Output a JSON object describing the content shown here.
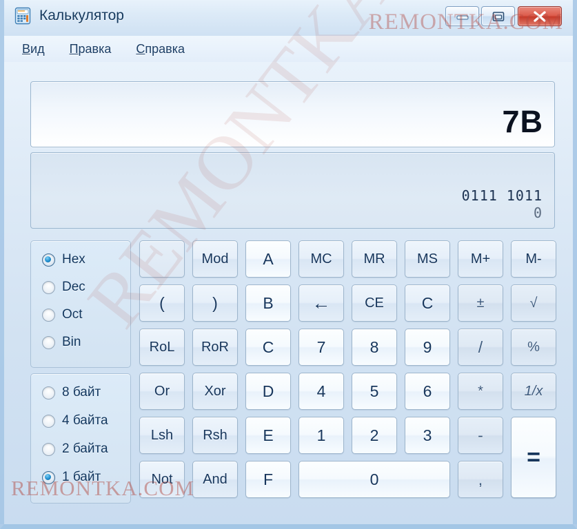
{
  "window": {
    "title": "Калькулятор",
    "icon": "calculator-icon",
    "controls": {
      "minimize": "minimize-icon",
      "maximize": "restore-icon",
      "close": "close-icon"
    }
  },
  "menu": {
    "items": [
      {
        "accel": "В",
        "rest": "ид"
      },
      {
        "accel": "П",
        "rest": "равка"
      },
      {
        "accel": "С",
        "rest": "правка"
      }
    ]
  },
  "display": {
    "value": "7B",
    "binary_line_1": "0111  1011",
    "binary_line_2": "0"
  },
  "base_group": {
    "options": [
      {
        "label": "Hex",
        "selected": true
      },
      {
        "label": "Dec",
        "selected": false
      },
      {
        "label": "Oct",
        "selected": false
      },
      {
        "label": "Bin",
        "selected": false
      }
    ]
  },
  "size_group": {
    "options": [
      {
        "label": "8 байт",
        "selected": false
      },
      {
        "label": "4 байта",
        "selected": false
      },
      {
        "label": "2 байта",
        "selected": false
      },
      {
        "label": "1 байт",
        "selected": true
      }
    ]
  },
  "keys": [
    {
      "name": "key-blank",
      "label": "",
      "style": "blank",
      "col": 0,
      "row": 0
    },
    {
      "name": "key-mod",
      "label": "Mod",
      "style": "op small",
      "col": 1,
      "row": 0
    },
    {
      "name": "key-hex-a",
      "label": "A",
      "style": "num",
      "col": 2,
      "row": 0
    },
    {
      "name": "key-mc",
      "label": "MC",
      "style": "op small",
      "col": 3,
      "row": 0
    },
    {
      "name": "key-mr",
      "label": "MR",
      "style": "op small",
      "col": 4,
      "row": 0
    },
    {
      "name": "key-ms",
      "label": "MS",
      "style": "op small",
      "col": 5,
      "row": 0
    },
    {
      "name": "key-m-plus",
      "label": "M+",
      "style": "op small",
      "col": 6,
      "row": 0
    },
    {
      "name": "key-m-minus",
      "label": "M-",
      "style": "op small",
      "col": 7,
      "row": 0
    },
    {
      "name": "key-paren-open",
      "label": "(",
      "style": "op",
      "col": 0,
      "row": 1
    },
    {
      "name": "key-paren-close",
      "label": ")",
      "style": "op",
      "col": 1,
      "row": 1
    },
    {
      "name": "key-hex-b",
      "label": "B",
      "style": "num",
      "col": 2,
      "row": 1
    },
    {
      "name": "key-backspace",
      "label": "←",
      "style": "op arrow",
      "col": 3,
      "row": 1
    },
    {
      "name": "key-ce",
      "label": "CE",
      "style": "op small",
      "col": 4,
      "row": 1
    },
    {
      "name": "key-c",
      "label": "C",
      "style": "op",
      "col": 5,
      "row": 1
    },
    {
      "name": "key-sign",
      "label": "±",
      "style": "dim small",
      "col": 6,
      "row": 1
    },
    {
      "name": "key-sqrt",
      "label": "√",
      "style": "dim small",
      "col": 7,
      "row": 1
    },
    {
      "name": "key-rol",
      "label": "RoL",
      "style": "op small",
      "col": 0,
      "row": 2
    },
    {
      "name": "key-ror",
      "label": "RoR",
      "style": "op small",
      "col": 1,
      "row": 2
    },
    {
      "name": "key-hex-c",
      "label": "C",
      "style": "num",
      "col": 2,
      "row": 2
    },
    {
      "name": "key-7",
      "label": "7",
      "style": "num",
      "col": 3,
      "row": 2
    },
    {
      "name": "key-8",
      "label": "8",
      "style": "num",
      "col": 4,
      "row": 2
    },
    {
      "name": "key-9",
      "label": "9",
      "style": "num",
      "col": 5,
      "row": 2
    },
    {
      "name": "key-divide",
      "label": "/",
      "style": "dim",
      "col": 6,
      "row": 2
    },
    {
      "name": "key-percent",
      "label": "%",
      "style": "dim small",
      "col": 7,
      "row": 2
    },
    {
      "name": "key-or",
      "label": "Or",
      "style": "op small",
      "col": 0,
      "row": 3
    },
    {
      "name": "key-xor",
      "label": "Xor",
      "style": "op small",
      "col": 1,
      "row": 3
    },
    {
      "name": "key-hex-d",
      "label": "D",
      "style": "num",
      "col": 2,
      "row": 3
    },
    {
      "name": "key-4",
      "label": "4",
      "style": "num",
      "col": 3,
      "row": 3
    },
    {
      "name": "key-5",
      "label": "5",
      "style": "num",
      "col": 4,
      "row": 3
    },
    {
      "name": "key-6",
      "label": "6",
      "style": "num",
      "col": 5,
      "row": 3
    },
    {
      "name": "key-multiply",
      "label": "*",
      "style": "dim small",
      "col": 6,
      "row": 3
    },
    {
      "name": "key-reciprocal",
      "label": "1/x",
      "style": "dim small italic",
      "col": 7,
      "row": 3
    },
    {
      "name": "key-lsh",
      "label": "Lsh",
      "style": "op small",
      "col": 0,
      "row": 4
    },
    {
      "name": "key-rsh",
      "label": "Rsh",
      "style": "op small",
      "col": 1,
      "row": 4
    },
    {
      "name": "key-hex-e",
      "label": "E",
      "style": "num",
      "col": 2,
      "row": 4
    },
    {
      "name": "key-1",
      "label": "1",
      "style": "num",
      "col": 3,
      "row": 4
    },
    {
      "name": "key-2",
      "label": "2",
      "style": "num",
      "col": 4,
      "row": 4
    },
    {
      "name": "key-3",
      "label": "3",
      "style": "num",
      "col": 5,
      "row": 4
    },
    {
      "name": "key-subtract",
      "label": "-",
      "style": "dim",
      "col": 6,
      "row": 4
    },
    {
      "name": "key-not",
      "label": "Not",
      "style": "op small",
      "col": 0,
      "row": 5
    },
    {
      "name": "key-and",
      "label": "And",
      "style": "op small",
      "col": 1,
      "row": 5
    },
    {
      "name": "key-hex-f",
      "label": "F",
      "style": "num",
      "col": 2,
      "row": 5
    },
    {
      "name": "key-0",
      "label": "0",
      "style": "num wide",
      "col": 3,
      "row": 5
    },
    {
      "name": "key-decimal",
      "label": ",",
      "style": "dim",
      "col": 6,
      "row": 5
    },
    {
      "name": "key-add",
      "label": "+",
      "style": "dim",
      "col": 7,
      "row": 5
    }
  ],
  "equals_key": {
    "name": "key-equals",
    "label": "="
  },
  "watermarks": {
    "top": "REMONTKA.COM",
    "bottom": "REMONTKA.COM",
    "diagonal": "REMONTKA.COM"
  }
}
